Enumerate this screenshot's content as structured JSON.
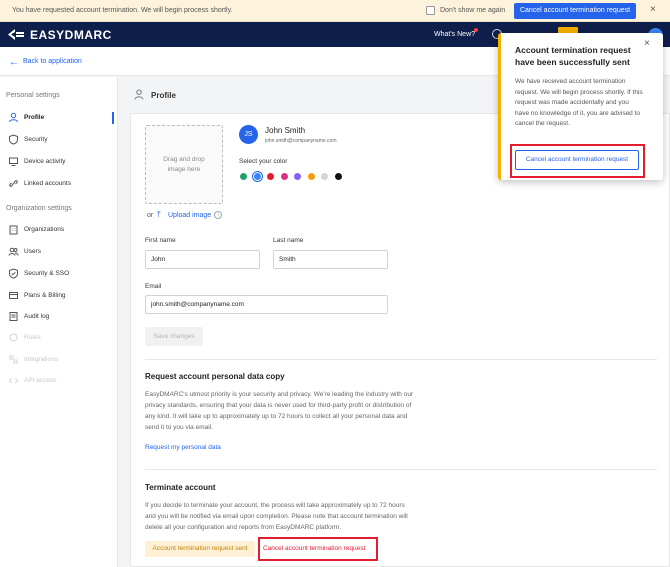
{
  "banner": {
    "message": "You have requested account termination. We will begin process shortly.",
    "dont_show_label": "Don't show me again",
    "cancel_button": "Cancel account termination request",
    "close_symbol": "×"
  },
  "topnav": {
    "logo_text": "EASYDMARC",
    "whats_new": "What's New?"
  },
  "back_link": "Back to application",
  "sidebar": {
    "personal_heading": "Personal settings",
    "personal_items": [
      {
        "label": "Profile",
        "icon": "user-icon"
      },
      {
        "label": "Security",
        "icon": "shield-icon"
      },
      {
        "label": "Device activity",
        "icon": "device-icon"
      },
      {
        "label": "Linked accounts",
        "icon": "link-icon"
      }
    ],
    "org_heading": "Organization settings",
    "org_items": [
      {
        "label": "Organizations",
        "icon": "organizations-icon"
      },
      {
        "label": "Users",
        "icon": "users-icon"
      },
      {
        "label": "Security & SSO",
        "icon": "shield-check-icon"
      },
      {
        "label": "Plans & Billing",
        "icon": "billing-icon"
      },
      {
        "label": "Audit log",
        "icon": "audit-log-icon"
      },
      {
        "label": "Roles",
        "icon": "roles-icon"
      },
      {
        "label": "Integrations",
        "icon": "integrations-icon"
      },
      {
        "label": "API access",
        "icon": "api-icon"
      }
    ]
  },
  "profile": {
    "title": "Profile",
    "dropzone_text": "Drag and drop image here",
    "or_text": "or",
    "upload_link": "Upload image",
    "avatar_initials": "JS",
    "name": "John Smith",
    "email_small": "john.smith@companyname.com",
    "color_label": "Select your color",
    "colors": [
      "#22a06b",
      "#3b82f6",
      "#e11d2e",
      "#d63384",
      "#8b5cf6",
      "#f59e0b",
      "#d1d5db",
      "#111111"
    ],
    "selected_color_index": 1,
    "first_name_label": "First name",
    "first_name_value": "John",
    "last_name_label": "Last name",
    "last_name_value": "Smith",
    "email_label": "Email",
    "email_value": "john.smith@companyname.com",
    "save_button": "Save changes"
  },
  "data_copy": {
    "title": "Request account personal data copy",
    "body": "EasyDMARC's utmost priority is your security and privacy. We're leading the industry with our privacy standards, ensuring that your data is never used for third-party profit or distribution of any kind. It will take up to approximately up to 72 hours to collect all your personal data and send it to you via email.",
    "link": "Request my personal data"
  },
  "terminate": {
    "title": "Terminate account",
    "body": "If you decide to terminate your account, the process will take approximately up to 72 hours and you will be notified via email upon completion. Please note that account termination will delete all your configuration and reports from EasyDMARC platform.",
    "sent_badge": "Account termination request sent",
    "cancel_link": "Cancel account termination request"
  },
  "toast": {
    "title": "Account termination request have been successfully sent",
    "body": "We have received account termination request. We will begin process shortly. If this request was made accidentally and you have no knowledge of it, you are advised to cancel the request.",
    "cancel_button": "Cancel account termination request",
    "close_symbol": "×"
  }
}
